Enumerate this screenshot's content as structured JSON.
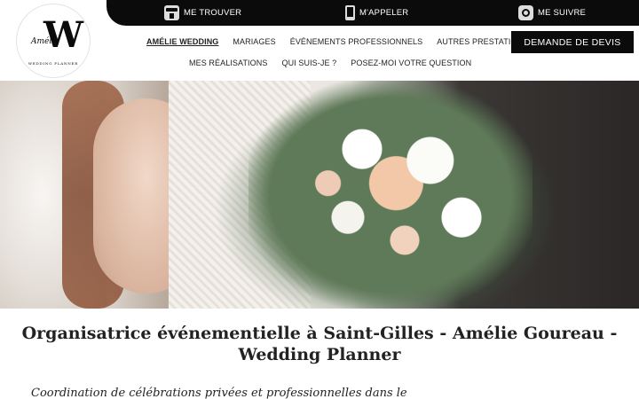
{
  "topbar": {
    "find_label": "ME TROUVER",
    "call_label": "M'APPELER",
    "follow_label": "ME SUIVRE"
  },
  "logo": {
    "script_text": "Amélie",
    "initial": "W",
    "tagline": "WEDDING PLANNER"
  },
  "nav": {
    "row1": [
      "AMÉLIE WEDDING",
      "MARIAGES",
      "ÉVÉNEMENTS PROFESSIONNELS",
      "AUTRES PRESTATIONS"
    ],
    "row2": [
      "MES RÉALISATIONS",
      "QUI SUIS-JE ?",
      "POSEZ-MOI VOTRE QUESTION"
    ]
  },
  "cta": {
    "devis_label": "DEMANDE DE DEVIS"
  },
  "page": {
    "title": "Organisatrice événementielle à Saint-Gilles - Amélie Goureau - Wedding Planner",
    "subtitle": "Coordination de célébrations privées et professionnelles dans le"
  },
  "colors": {
    "primary": "#0b0b0b",
    "background": "#ffffff",
    "text": "#222222"
  }
}
